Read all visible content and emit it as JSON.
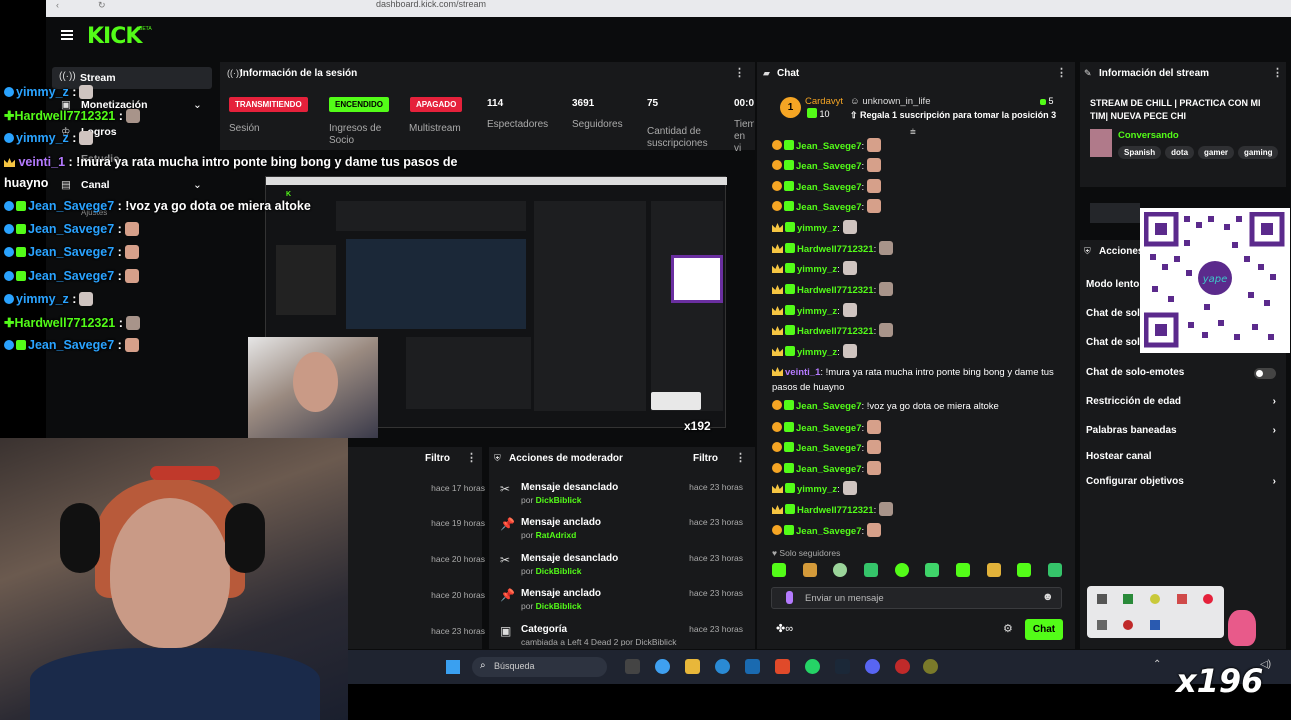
{
  "browser": {
    "url": "dashboard.kick.com/stream"
  },
  "brand": {
    "logo": "KICK",
    "beta": "BETA",
    "accent": "#53fc18"
  },
  "sidebar": {
    "items": [
      {
        "label": "Stream",
        "icon": "broadcast-icon"
      },
      {
        "label": "Monetización",
        "icon": "dollar-icon"
      },
      {
        "label": "Logros",
        "icon": "trophy-icon"
      },
      {
        "label": "Estudio",
        "icon": "studio-icon"
      },
      {
        "label": "Canal",
        "icon": "channel-icon"
      },
      {
        "label": "Ajustes",
        "icon": "gear-icon"
      }
    ]
  },
  "session": {
    "title": "Información de la sesión",
    "badges": [
      {
        "top": "TRANSMITIENDO",
        "bottom": "Sesión",
        "color": "#e5213b"
      },
      {
        "top": "ENCENDIDO",
        "bottom": "Ingresos de Socio",
        "color": "#53fc18"
      },
      {
        "top": "APAGADO",
        "bottom": "Multistream",
        "color": "#e5213b"
      }
    ],
    "stats": [
      {
        "value": "114",
        "label": "Espectadores"
      },
      {
        "value": "3691",
        "label": "Seguidores"
      },
      {
        "value": "75",
        "label": "Cantidad de suscripciones"
      },
      {
        "value": "00:0",
        "label": "Tiem en vi"
      }
    ]
  },
  "overlay_chat": [
    {
      "user": "yimmy_z",
      "color": "blue",
      "msg": ""
    },
    {
      "user": "Hardwell7712321",
      "color": "green",
      "msg": ""
    },
    {
      "user": "yimmy_z",
      "color": "blue",
      "msg": ""
    },
    {
      "user": "veinti_1",
      "color": "purple",
      "msg": "!mura ya rata mucha intro ponte bing bong y dame tus pasos de"
    },
    {
      "user": "",
      "color": "",
      "msg": "huayno"
    },
    {
      "user": "Jean_Savege7",
      "color": "blue",
      "msg": "!voz ya go dota oe miera altoke"
    },
    {
      "user": "Jean_Savege7",
      "color": "blue",
      "msg": ""
    },
    {
      "user": "Jean_Savege7",
      "color": "blue",
      "msg": ""
    },
    {
      "user": "Jean_Savege7",
      "color": "blue",
      "msg": ""
    },
    {
      "user": "yimmy_z",
      "color": "blue",
      "msg": ""
    },
    {
      "user": "Hardwell7712321",
      "color": "green",
      "msg": ""
    },
    {
      "user": "Jean_Savege7",
      "color": "blue",
      "msg": ""
    }
  ],
  "moderator": {
    "title": "Acciones de moderador",
    "filter": "Filtro",
    "left_filter": "Filtro",
    "left_times": [
      "hace 17 horas",
      "hace 19 horas",
      "hace 20 horas",
      "hace 20 horas",
      "hace 23 horas"
    ],
    "rows": [
      {
        "action": "Mensaje desanclado",
        "by": "por",
        "user": "DickBiblick",
        "time": "hace 23 horas",
        "icon": "unpin-icon"
      },
      {
        "action": "Mensaje anclado",
        "by": "por",
        "user": "RatAdrixd",
        "time": "hace 23 horas",
        "icon": "pin-icon"
      },
      {
        "action": "Mensaje desanclado",
        "by": "por",
        "user": "DickBiblick",
        "time": "hace 23 horas",
        "icon": "unpin-icon"
      },
      {
        "action": "Mensaje anclado",
        "by": "por",
        "user": "DickBiblick",
        "time": "hace 23 horas",
        "icon": "pin-icon"
      },
      {
        "action": "Categoría",
        "by": "cambiada a Left 4 Dead 2 por DickBiblick",
        "user": "",
        "time": "hace 23 horas",
        "icon": "category-icon"
      }
    ]
  },
  "chat": {
    "title": "Chat",
    "gifter": {
      "user": "Cardavyt",
      "count": "10"
    },
    "pinned": {
      "user": "unknown_in_life",
      "count": "5",
      "text": "Regala 1 suscripción para tomar la posición 3"
    },
    "lines": [
      {
        "user": "Jean_Savege7",
        "badge": "gold",
        "msg": ""
      },
      {
        "user": "Jean_Savege7",
        "badge": "gold",
        "msg": ""
      },
      {
        "user": "Jean_Savege7",
        "badge": "gold",
        "msg": ""
      },
      {
        "user": "Jean_Savege7",
        "badge": "gold",
        "msg": ""
      },
      {
        "user": "yimmy_z",
        "badge": "crown",
        "msg": ""
      },
      {
        "user": "Hardwell7712321",
        "badge": "crown",
        "msg": ""
      },
      {
        "user": "yimmy_z",
        "badge": "crown",
        "msg": ""
      },
      {
        "user": "Hardwell7712321",
        "badge": "crown",
        "msg": ""
      },
      {
        "user": "yimmy_z",
        "badge": "crown",
        "msg": ""
      },
      {
        "user": "Hardwell7712321",
        "badge": "crown",
        "msg": ""
      },
      {
        "user": "yimmy_z",
        "badge": "crown",
        "msg": ""
      }
    ],
    "veinti": {
      "user": "veinti_1",
      "msg1": "!mura ya rata mucha intro ponte bing bong y dame tus",
      "msg2": "pasos de huayno"
    },
    "lines2": [
      {
        "user": "Jean_Savege7",
        "badge": "gold",
        "msg": "!voz ya go dota oe miera altoke"
      },
      {
        "user": "Jean_Savege7",
        "badge": "gold",
        "msg": ""
      },
      {
        "user": "Jean_Savege7",
        "badge": "gold",
        "msg": ""
      },
      {
        "user": "Jean_Savege7",
        "badge": "gold",
        "msg": ""
      },
      {
        "user": "yimmy_z",
        "badge": "crown",
        "msg": ""
      },
      {
        "user": "Hardwell7712321",
        "badge": "crown",
        "msg": ""
      },
      {
        "user": "Jean_Savege7",
        "badge": "gold",
        "msg": ""
      }
    ],
    "followers_only": "Solo seguidores",
    "input_placeholder": "Enviar un mensaje",
    "send_label": "Chat"
  },
  "stream_info": {
    "title": "Información del stream",
    "stream_title": "STREAM DE CHILL | PRACTICA CON MI TIM| NUEVA PECE CHI",
    "category": "Conversando",
    "tags": [
      "Spanish",
      "dota",
      "gamer",
      "gaming"
    ]
  },
  "actions": {
    "title": "Acciones",
    "items": [
      {
        "label": "Modo lento",
        "arrow": false
      },
      {
        "label": "Chat de solo",
        "arrow": false
      },
      {
        "label": "Chat de solo",
        "arrow": false
      },
      {
        "label": "Chat de solo-emotes",
        "arrow": false,
        "toggle": true
      },
      {
        "label": "Restricción de edad",
        "arrow": true
      },
      {
        "label": "Palabras baneadas",
        "arrow": true
      },
      {
        "label": "Hostear canal",
        "arrow": false
      },
      {
        "label": "Configurar objetivos",
        "arrow": true
      }
    ]
  },
  "taskbar": {
    "search": "Búsqueda"
  },
  "combo": {
    "preview": "x192",
    "main": "x196"
  }
}
